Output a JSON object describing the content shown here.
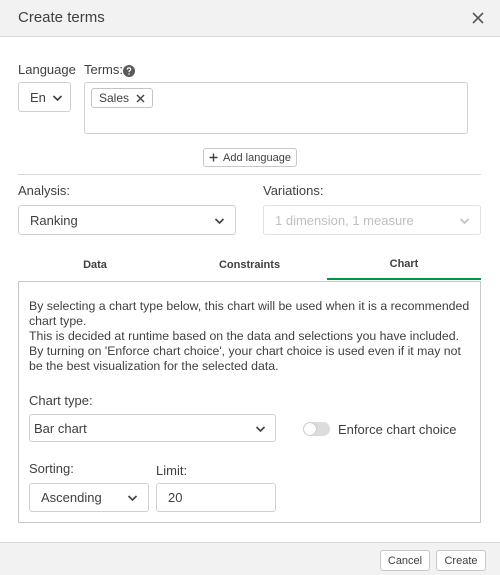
{
  "dialog": {
    "title": "Create terms"
  },
  "language": {
    "label": "Language",
    "value": "En"
  },
  "terms": {
    "label": "Terms:",
    "chips": [
      "Sales"
    ]
  },
  "add_language": {
    "label": "Add language"
  },
  "analysis": {
    "label": "Analysis:",
    "value": "Ranking"
  },
  "variations": {
    "label": "Variations:",
    "value": "1 dimension, 1 measure"
  },
  "tabs": [
    {
      "label": "Data",
      "active": false
    },
    {
      "label": "Constraints",
      "active": false
    },
    {
      "label": "Chart",
      "active": true
    }
  ],
  "chart_tab": {
    "description": [
      "By selecting a chart type below, this chart will be used when it is a recommended chart type.",
      "This is decided at runtime based on the data and selections you have included.",
      "By turning on 'Enforce chart choice', your chart choice is used even if it may not be the best visualization for the selected data."
    ],
    "chart_type_label": "Chart type:",
    "chart_type_value": "Bar chart",
    "enforce_label": "Enforce chart choice",
    "enforce_on": false,
    "sorting_label": "Sorting:",
    "sorting_value": "Ascending",
    "limit_label": "Limit:",
    "limit_value": "20"
  },
  "footer": {
    "cancel_label": "Cancel",
    "create_label": "Create"
  },
  "colors": {
    "accent": "#009845",
    "header_bg": "#f2f2f2",
    "border": "#d0d0d0",
    "text": "#404040",
    "disabled_text": "#bfbfbf"
  }
}
